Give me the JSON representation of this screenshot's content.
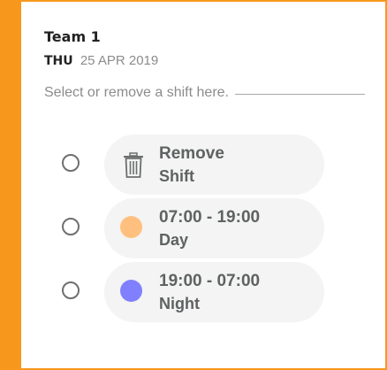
{
  "header": {
    "title": "Team 1",
    "day": "THU",
    "date": "25 APR 2019"
  },
  "instructions": "Select or remove a shift here.",
  "colors": {
    "accent": "#F7981D",
    "day": "#FFC07F",
    "night": "#8080FF"
  },
  "options": [
    {
      "icon": "trash-icon",
      "primary": "Remove",
      "secondary": "Shift",
      "selected": false
    },
    {
      "icon": "day-dot-icon",
      "primary": "07:00 - 19:00",
      "secondary": "Day",
      "selected": false
    },
    {
      "icon": "night-dot-icon",
      "primary": "19:00 - 07:00",
      "secondary": "Night",
      "selected": false
    }
  ]
}
